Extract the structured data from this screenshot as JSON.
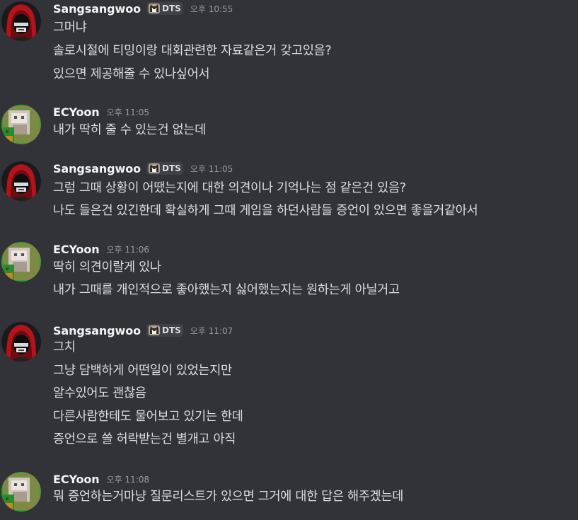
{
  "messages": [
    {
      "username": "Sangsangwoo",
      "tag": "DTS",
      "timestamp": "오후 10:55",
      "lines": [
        "그머냐",
        "솔로시절에 티밍이랑 대회관련한 자료같은거 갖고있음?",
        "있으면 제공해줄 수 있나싶어서"
      ]
    },
    {
      "username": "ECYoon",
      "timestamp": "오후 11:05",
      "lines": [
        "내가 딱히 줄 수 있는건 없는데"
      ]
    },
    {
      "username": "Sangsangwoo",
      "tag": "DTS",
      "timestamp": "오후 11:05",
      "lines": [
        "그럼 그때 상황이 어땠는지에 대한 의견이나 기억나는 점 같은건 있음?",
        "나도 들은건 있긴한데 확실하게 그때 게임을 하던사람들 증언이 있으면 좋을거같아서"
      ]
    },
    {
      "username": "ECYoon",
      "timestamp": "오후 11:06",
      "lines": [
        "딱히 의견이랄게 있나",
        "내가 그때를 개인적으로 좋아했는지 싫어했는지는 원하는게 아닐거고"
      ]
    },
    {
      "username": "Sangsangwoo",
      "tag": "DTS",
      "timestamp": "오후 11:07",
      "lines": [
        "그치",
        "그냥 담백하게 어떤일이 있었는지만",
        "알수있어도 괜찮음",
        "다른사람한테도 물어보고 있기는 한데",
        "증언으로 쓸 허락받는건 별개고 아직"
      ]
    },
    {
      "username": "ECYoon",
      "timestamp": "오후 11:08",
      "lines": [
        "뭐 증언하는거마냥 질문리스트가 있으면 그거에 대한 답은 해주겠는데"
      ]
    }
  ]
}
